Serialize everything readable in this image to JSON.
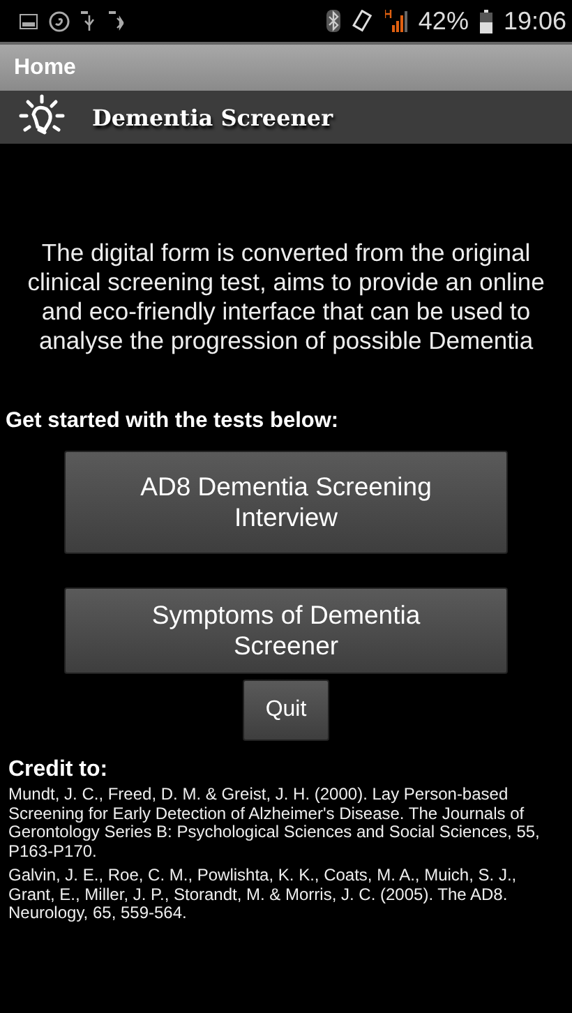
{
  "status_bar": {
    "battery": "42%",
    "time": "19:06"
  },
  "action_bar": {
    "title": "Home"
  },
  "header": {
    "title": "Dementia Screener"
  },
  "intro": "The digital form is converted from the original clinical screening test, aims to provide an online and eco-friendly interface that can be used to analyse the progression of possible Dementia",
  "prompt": "Get started with the tests below:",
  "buttons": [
    {
      "label": "AD8 Dementia Screening Interview",
      "kind": "large"
    },
    {
      "label": "Symptoms of Dementia Screener",
      "kind": "large"
    },
    {
      "label": "Quit",
      "kind": "small"
    }
  ],
  "credit": {
    "heading": "Credit to:",
    "references": [
      "Mundt, J. C., Freed, D. M. & Greist, J. H. (2000). Lay Person-based Screening for Early Detection of Alzheimer's Disease. The Journals of Gerontology Series B: Psychological Sciences and Social Sciences, 55, P163-P170.",
      "Galvin, J. E., Roe, C. M., Powlishta, K. K., Coats, M. A., Muich, S. J., Grant, E., Miller, J. P., Storandt, M. & Morris, J. C. (2005). The AD8. Neurology, 65, 559-564."
    ]
  }
}
